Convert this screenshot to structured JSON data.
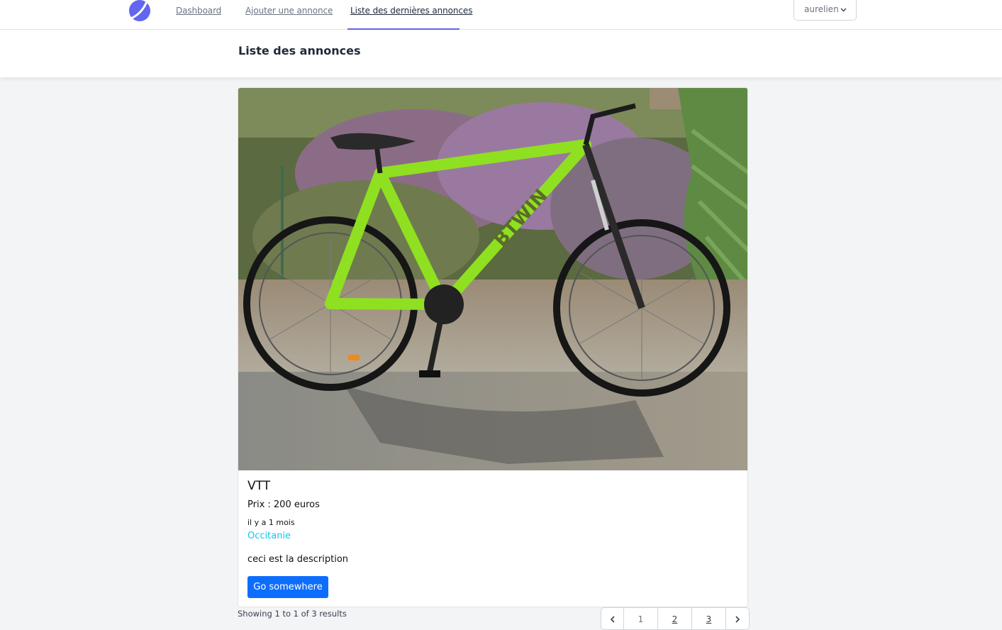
{
  "nav": {
    "links": [
      {
        "label": "Dashboard"
      },
      {
        "label": "Ajouter une annonce"
      },
      {
        "label": "Liste des dernières annonces"
      }
    ],
    "user": "aurelien"
  },
  "page": {
    "title": "Liste des annonces"
  },
  "card": {
    "title": "VTT",
    "price": "Prix : 200 euros",
    "time": "il y a 1 mois",
    "region": "Occitanie",
    "description": "ceci est la description",
    "button": "Go somewhere",
    "image_alt_text": "BTWIN"
  },
  "pagination": {
    "summary": "Showing 1 to 1 of 3 results",
    "pages": [
      "1",
      "2",
      "3"
    ],
    "current": "1"
  },
  "colors": {
    "accent": "#6366f1",
    "button": "#0d6efd",
    "region": "#0dcaf0"
  }
}
